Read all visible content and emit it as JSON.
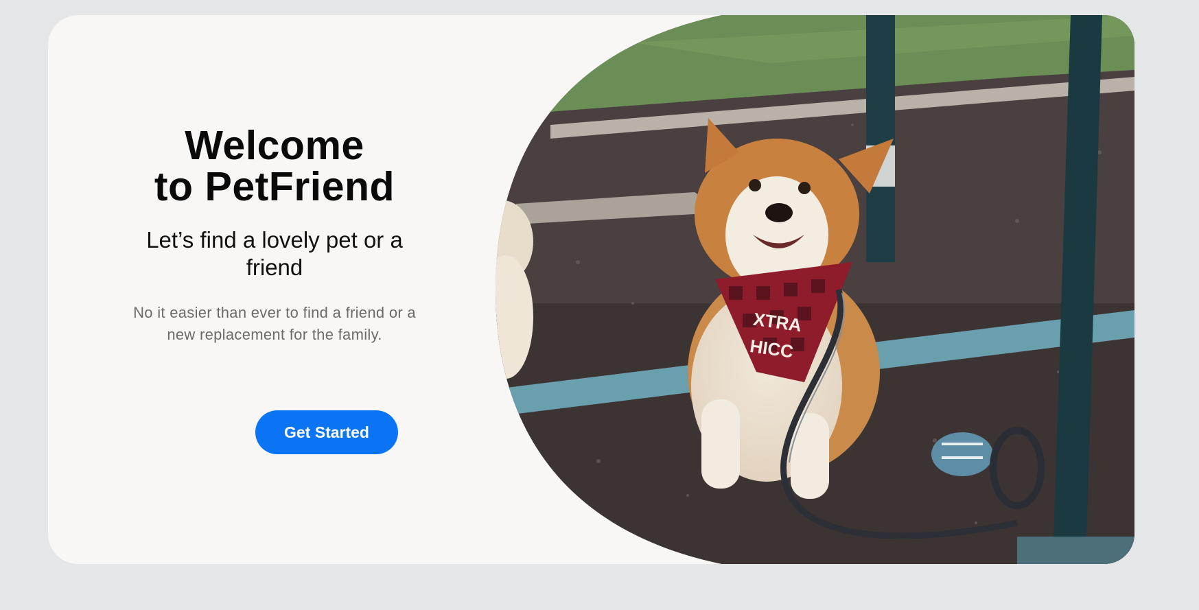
{
  "hero": {
    "title_line1": "Welcome",
    "title_line2": "to PetFriend",
    "subtitle": "Let’s find a lovely pet or a friend",
    "description": "No it easier than ever to find a friend or a new replacement for the family.",
    "cta_label": "Get Started",
    "bandana_text_line1": "XTRA",
    "bandana_text_line2": "HICC"
  },
  "colors": {
    "page_background": "#e5e6e8",
    "card_background": "#f8f7f5",
    "accent": "#0a74f5",
    "title_text": "#0a0a0a",
    "body_text": "#6b6b6b"
  },
  "photo": {
    "subject": "corgi-with-bandana"
  }
}
